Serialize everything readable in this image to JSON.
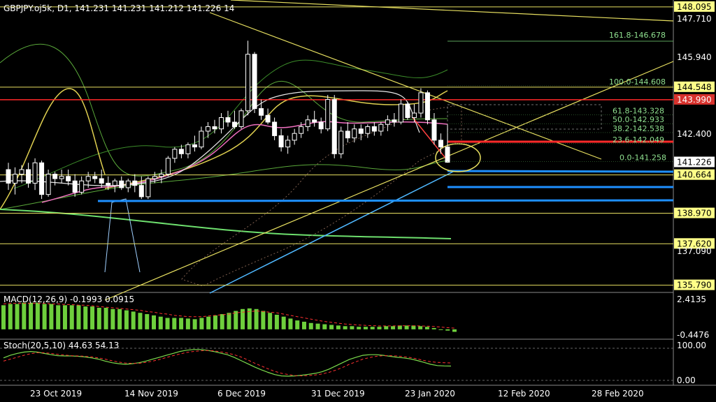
{
  "header": {
    "symbol_line": "GBPJPY.oj5k, D1, 141.231 141.231 141.212 141.226 14"
  },
  "price_axis": {
    "labels": [
      "147.710",
      "145.940",
      "142.400",
      "137.090"
    ],
    "right_boxes": [
      {
        "value": "148.095",
        "bg": "#ffff88",
        "fg": "#000000"
      },
      {
        "value": "144.548",
        "bg": "#ffff88",
        "fg": "#000000"
      },
      {
        "value": "143.990",
        "bg": "#d8322d",
        "fg": "#ffffff"
      },
      {
        "value": "141.226",
        "bg": "#ffffff",
        "fg": "#000000"
      },
      {
        "value": "140.664",
        "bg": "#ffff88",
        "fg": "#000000"
      },
      {
        "value": "138.970",
        "bg": "#ffff88",
        "fg": "#000000"
      },
      {
        "value": "137.620",
        "bg": "#ffff88",
        "fg": "#000000"
      },
      {
        "value": "135.790",
        "bg": "#ffff88",
        "fg": "#000000"
      }
    ]
  },
  "fibonacci": [
    {
      "label": "161.8-146.678",
      "price": 146.678
    },
    {
      "label": "100.0-144.608",
      "price": 144.608
    },
    {
      "label": "61.8-143.328",
      "price": 143.328
    },
    {
      "label": "50.0-142.933",
      "price": 142.933
    },
    {
      "label": "38.2-142.538",
      "price": 142.538
    },
    {
      "label": "23.6-142.049",
      "price": 142.049
    },
    {
      "label": "0.0-141.258",
      "price": 141.258
    }
  ],
  "macd": {
    "label": "MACD(12,26,9) -0.1993 0.0915",
    "axis_top": "2.4135",
    "axis_bottom": "-0.4476"
  },
  "stoch": {
    "label": "Stoch(20,5,10) 44.63 54.13",
    "axis_top": "100.00",
    "axis_bottom": "0.00"
  },
  "time_axis": {
    "labels": [
      "23 Oct 2019",
      "14 Nov 2019",
      "6 Dec 2019",
      "31 Dec 2019",
      "23 Jan 2020",
      "12 Feb 2020",
      "28 Feb 2020"
    ]
  },
  "colors": {
    "background": "#000000",
    "candle": "#ffffff",
    "support_blue": "#1e90ff",
    "resistance_red": "#ff2a2a",
    "trend_yellow": "#e8e060",
    "ma_green": "#7cdc4c",
    "fib_green": "#8fe08f",
    "macd_bar": "#6ecf3c",
    "signal_red": "#ff3030"
  },
  "chart_data": {
    "type": "candlestick",
    "symbol": "GBPJPY.oj5k",
    "timeframe": "D1",
    "last_bar": {
      "open": 141.231,
      "high": 141.231,
      "low": 141.212,
      "close": 141.226
    },
    "ylim": [
      135.5,
      148.4
    ],
    "x_ticks": [
      "23 Oct 2019",
      "14 Nov 2019",
      "6 Dec 2019",
      "31 Dec 2019",
      "23 Jan 2020",
      "12 Feb 2020",
      "28 Feb 2020"
    ],
    "candles": [
      {
        "o": 140.9,
        "h": 141.2,
        "l": 140.0,
        "c": 140.3
      },
      {
        "o": 140.3,
        "h": 141.0,
        "l": 139.8,
        "c": 140.7
      },
      {
        "o": 140.7,
        "h": 141.1,
        "l": 140.3,
        "c": 140.9
      },
      {
        "o": 140.9,
        "h": 141.2,
        "l": 140.1,
        "c": 140.3
      },
      {
        "o": 140.3,
        "h": 141.4,
        "l": 140.0,
        "c": 141.2
      },
      {
        "o": 141.2,
        "h": 141.3,
        "l": 139.6,
        "c": 139.8
      },
      {
        "o": 139.8,
        "h": 140.9,
        "l": 139.7,
        "c": 140.7
      },
      {
        "o": 140.7,
        "h": 140.8,
        "l": 140.2,
        "c": 140.5
      },
      {
        "o": 140.5,
        "h": 140.9,
        "l": 140.3,
        "c": 140.6
      },
      {
        "o": 140.6,
        "h": 140.9,
        "l": 140.2,
        "c": 140.4
      },
      {
        "o": 140.4,
        "h": 140.7,
        "l": 139.7,
        "c": 139.9
      },
      {
        "o": 139.9,
        "h": 140.6,
        "l": 139.8,
        "c": 140.4
      },
      {
        "o": 140.4,
        "h": 140.8,
        "l": 140.1,
        "c": 140.6
      },
      {
        "o": 140.6,
        "h": 140.8,
        "l": 140.3,
        "c": 140.5
      },
      {
        "o": 140.5,
        "h": 140.9,
        "l": 140.1,
        "c": 140.3
      },
      {
        "o": 140.3,
        "h": 140.6,
        "l": 140.0,
        "c": 140.2
      },
      {
        "o": 140.2,
        "h": 140.5,
        "l": 139.9,
        "c": 140.4
      },
      {
        "o": 140.4,
        "h": 140.6,
        "l": 140.0,
        "c": 140.1
      },
      {
        "o": 140.1,
        "h": 140.5,
        "l": 139.9,
        "c": 140.4
      },
      {
        "o": 140.4,
        "h": 140.7,
        "l": 139.9,
        "c": 140.2
      },
      {
        "o": 140.2,
        "h": 140.6,
        "l": 139.6,
        "c": 139.7
      },
      {
        "o": 139.7,
        "h": 140.6,
        "l": 139.6,
        "c": 140.5
      },
      {
        "o": 140.5,
        "h": 140.8,
        "l": 140.3,
        "c": 140.6
      },
      {
        "o": 140.6,
        "h": 140.9,
        "l": 140.3,
        "c": 140.7
      },
      {
        "o": 140.7,
        "h": 141.5,
        "l": 140.6,
        "c": 141.4
      },
      {
        "o": 141.4,
        "h": 141.9,
        "l": 141.2,
        "c": 141.8
      },
      {
        "o": 141.8,
        "h": 142.0,
        "l": 141.4,
        "c": 141.6
      },
      {
        "o": 141.6,
        "h": 142.1,
        "l": 141.4,
        "c": 142.0
      },
      {
        "o": 142.0,
        "h": 142.4,
        "l": 141.7,
        "c": 141.9
      },
      {
        "o": 141.9,
        "h": 142.8,
        "l": 141.8,
        "c": 142.6
      },
      {
        "o": 142.6,
        "h": 143.0,
        "l": 142.3,
        "c": 142.8
      },
      {
        "o": 142.8,
        "h": 143.1,
        "l": 142.5,
        "c": 142.7
      },
      {
        "o": 142.7,
        "h": 143.4,
        "l": 142.5,
        "c": 143.2
      },
      {
        "o": 143.2,
        "h": 143.5,
        "l": 142.8,
        "c": 143.0
      },
      {
        "o": 143.0,
        "h": 143.5,
        "l": 142.7,
        "c": 142.8
      },
      {
        "o": 142.8,
        "h": 143.6,
        "l": 142.7,
        "c": 143.5
      },
      {
        "o": 143.5,
        "h": 146.6,
        "l": 143.3,
        "c": 146.0
      },
      {
        "o": 146.0,
        "h": 146.1,
        "l": 143.4,
        "c": 143.6
      },
      {
        "o": 143.6,
        "h": 144.0,
        "l": 143.1,
        "c": 143.3
      },
      {
        "o": 143.3,
        "h": 143.6,
        "l": 142.9,
        "c": 143.0
      },
      {
        "o": 143.0,
        "h": 143.2,
        "l": 142.2,
        "c": 142.4
      },
      {
        "o": 142.4,
        "h": 142.7,
        "l": 141.7,
        "c": 141.9
      },
      {
        "o": 141.9,
        "h": 142.4,
        "l": 141.6,
        "c": 142.2
      },
      {
        "o": 142.2,
        "h": 142.7,
        "l": 142.0,
        "c": 142.5
      },
      {
        "o": 142.5,
        "h": 143.0,
        "l": 142.3,
        "c": 142.8
      },
      {
        "o": 142.8,
        "h": 143.3,
        "l": 142.6,
        "c": 143.1
      },
      {
        "o": 143.1,
        "h": 143.5,
        "l": 142.8,
        "c": 143.0
      },
      {
        "o": 143.0,
        "h": 143.2,
        "l": 142.5,
        "c": 142.7
      },
      {
        "o": 142.7,
        "h": 144.2,
        "l": 142.6,
        "c": 144.0
      },
      {
        "o": 144.0,
        "h": 144.2,
        "l": 141.4,
        "c": 141.6
      },
      {
        "o": 141.6,
        "h": 142.8,
        "l": 141.4,
        "c": 142.6
      },
      {
        "o": 142.6,
        "h": 143.0,
        "l": 142.1,
        "c": 142.3
      },
      {
        "o": 142.3,
        "h": 142.9,
        "l": 142.1,
        "c": 142.7
      },
      {
        "o": 142.7,
        "h": 142.9,
        "l": 142.2,
        "c": 142.5
      },
      {
        "o": 142.5,
        "h": 142.9,
        "l": 142.3,
        "c": 142.8
      },
      {
        "o": 142.8,
        "h": 143.0,
        "l": 142.4,
        "c": 142.6
      },
      {
        "o": 142.6,
        "h": 143.0,
        "l": 142.4,
        "c": 142.9
      },
      {
        "o": 142.9,
        "h": 143.3,
        "l": 142.6,
        "c": 143.1
      },
      {
        "o": 143.1,
        "h": 143.4,
        "l": 142.8,
        "c": 143.0
      },
      {
        "o": 143.0,
        "h": 144.0,
        "l": 142.9,
        "c": 143.8
      },
      {
        "o": 143.8,
        "h": 143.9,
        "l": 143.1,
        "c": 143.2
      },
      {
        "o": 143.2,
        "h": 143.8,
        "l": 143.0,
        "c": 143.4
      },
      {
        "o": 143.4,
        "h": 144.5,
        "l": 143.2,
        "c": 144.3
      },
      {
        "o": 144.3,
        "h": 144.4,
        "l": 142.9,
        "c": 143.1
      },
      {
        "o": 143.1,
        "h": 143.4,
        "l": 142.0,
        "c": 142.2
      },
      {
        "o": 142.2,
        "h": 142.5,
        "l": 141.6,
        "c": 141.9
      },
      {
        "o": 141.9,
        "h": 142.9,
        "l": 141.2,
        "c": 141.226
      }
    ],
    "horizontal_levels": [
      {
        "price": 148.095,
        "color": "#e8e060"
      },
      {
        "price": 144.548,
        "color": "#e8e060"
      },
      {
        "price": 143.99,
        "color": "#ff2a2a"
      },
      {
        "price": 140.664,
        "color": "#e8e060"
      },
      {
        "price": 138.97,
        "color": "#e8e060"
      },
      {
        "price": 137.62,
        "color": "#e8e060"
      },
      {
        "price": 135.79,
        "color": "#e8e060"
      }
    ],
    "macd_hist": [
      1.9,
      2.0,
      2.0,
      2.1,
      2.1,
      2.1,
      2.0,
      2.0,
      1.9,
      1.9,
      1.9,
      1.9,
      1.8,
      1.8,
      1.7,
      1.7,
      1.6,
      1.6,
      1.5,
      1.4,
      1.3,
      1.2,
      1.1,
      1.0,
      0.9,
      0.9,
      0.9,
      0.85,
      0.8,
      0.9,
      1.0,
      1.1,
      1.2,
      1.3,
      1.45,
      1.6,
      1.65,
      1.6,
      1.45,
      1.3,
      1.15,
      1.0,
      0.85,
      0.7,
      0.6,
      0.5,
      0.45,
      0.4,
      0.35,
      0.3,
      0.25,
      0.25,
      0.2,
      0.2,
      0.2,
      0.2,
      0.25,
      0.25,
      0.3,
      0.3,
      0.3,
      0.25,
      0.2,
      0.1,
      0.0,
      -0.1,
      -0.1993
    ],
    "macd_signal": [
      2.0,
      2.05,
      2.05,
      2.05,
      2.05,
      2.05,
      2.05,
      2.0,
      2.0,
      1.95,
      1.95,
      1.9,
      1.9,
      1.85,
      1.8,
      1.75,
      1.7,
      1.65,
      1.6,
      1.55,
      1.5,
      1.4,
      1.35,
      1.25,
      1.2,
      1.1,
      1.05,
      1.0,
      1.0,
      1.0,
      1.05,
      1.1,
      1.15,
      1.2,
      1.3,
      1.35,
      1.4,
      1.45,
      1.4,
      1.35,
      1.3,
      1.2,
      1.1,
      1.0,
      0.9,
      0.8,
      0.7,
      0.62,
      0.55,
      0.48,
      0.42,
      0.38,
      0.34,
      0.31,
      0.29,
      0.27,
      0.27,
      0.27,
      0.28,
      0.28,
      0.28,
      0.27,
      0.25,
      0.22,
      0.18,
      0.13,
      0.0915
    ],
    "stoch_main": [
      70,
      78,
      84,
      88,
      90,
      88,
      84,
      80,
      77,
      76,
      76,
      75,
      73,
      70,
      66,
      60,
      55,
      52,
      50,
      52,
      55,
      60,
      66,
      72,
      78,
      84,
      90,
      94,
      96,
      96,
      94,
      90,
      85,
      80,
      72,
      62,
      52,
      42,
      33,
      25,
      18,
      14,
      13,
      14,
      16,
      19,
      22,
      27,
      35,
      45,
      55,
      65,
      72,
      78,
      80,
      80,
      78,
      75,
      72,
      70,
      67,
      62,
      56,
      50,
      46,
      45,
      44.63
    ],
    "stoch_signal": [
      60,
      66,
      72,
      78,
      83,
      86,
      86,
      84,
      81,
      79,
      77,
      76,
      75,
      73,
      70,
      66,
      61,
      57,
      54,
      53,
      53,
      56,
      60,
      65,
      71,
      77,
      82,
      87,
      90,
      92,
      93,
      92,
      89,
      85,
      80,
      73,
      64,
      54,
      45,
      36,
      28,
      22,
      18,
      15,
      14,
      15,
      17,
      20,
      25,
      32,
      40,
      50,
      58,
      66,
      71,
      75,
      77,
      77,
      76,
      74,
      71,
      67,
      62,
      58,
      56,
      55,
      54.13
    ]
  }
}
